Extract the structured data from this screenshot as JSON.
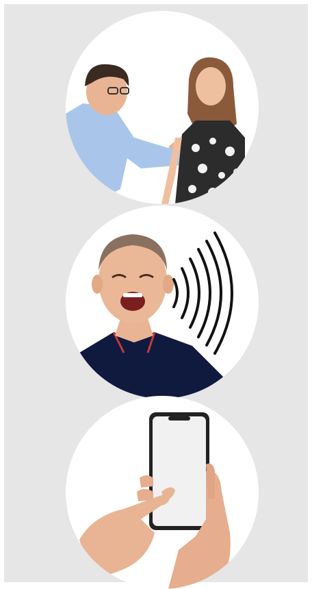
{
  "images": [
    {
      "icon": "unwanted-touch-illustration"
    },
    {
      "icon": "shouting-man-illustration"
    },
    {
      "icon": "phone-call-illustration"
    }
  ],
  "colors": {
    "panel_background": "#e6e6e6",
    "circle_background": "#ffffff",
    "navy_shirt": "#101a3f",
    "blue_shirt": "#a9c6ea",
    "skin": "#e9b494"
  }
}
